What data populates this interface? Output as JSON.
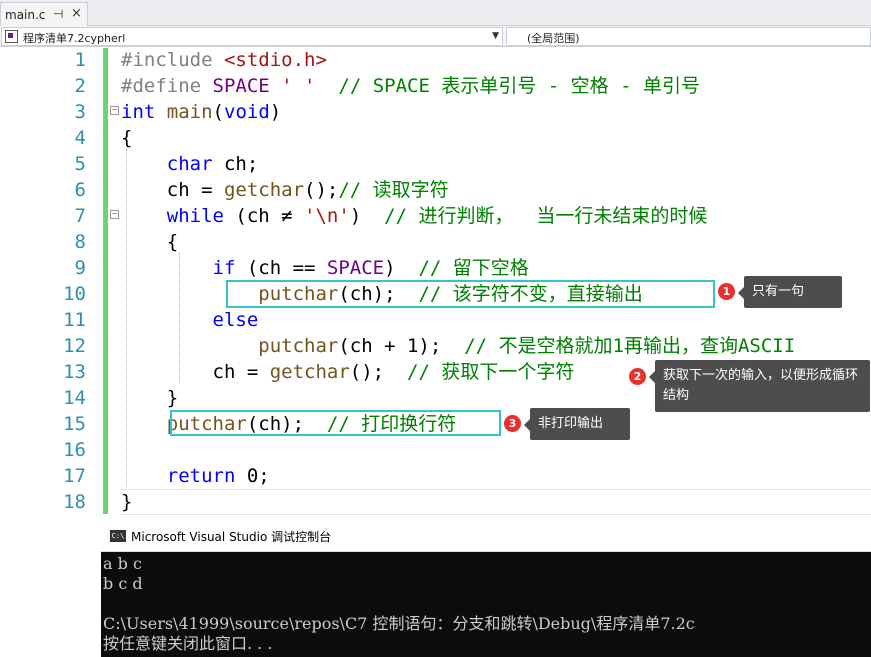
{
  "tab": {
    "label": "main.c",
    "pin_icon": "pin-icon",
    "close_icon": "close-icon"
  },
  "navbar": {
    "project": "程序清单7.2cypherl",
    "scope": "(全局范围)"
  },
  "editor": {
    "line_numbers": [
      "1",
      "2",
      "3",
      "4",
      "5",
      "6",
      "7",
      "8",
      "9",
      "10",
      "11",
      "12",
      "13",
      "14",
      "15",
      "16",
      "17",
      "18"
    ],
    "lines": [
      {
        "parts": [
          {
            "c": "pp",
            "t": "#include "
          },
          {
            "c": "inc",
            "t": "<stdio.h>"
          }
        ]
      },
      {
        "parts": [
          {
            "c": "pp",
            "t": "#define "
          },
          {
            "c": "mac",
            "t": "SPACE"
          },
          {
            "c": "op",
            "t": " "
          },
          {
            "c": "str",
            "t": "' '"
          },
          {
            "c": "op",
            "t": "  "
          },
          {
            "c": "cm",
            "t": "// SPACE 表示单引号 - 空格 - 单引号"
          }
        ]
      },
      {
        "parts": [
          {
            "c": "kw",
            "t": "int"
          },
          {
            "c": "op",
            "t": " "
          },
          {
            "c": "fn",
            "t": "main"
          },
          {
            "c": "op",
            "t": "("
          },
          {
            "c": "kw",
            "t": "void"
          },
          {
            "c": "op",
            "t": ")"
          }
        ]
      },
      {
        "parts": [
          {
            "c": "op",
            "t": "{"
          }
        ]
      },
      {
        "parts": [
          {
            "c": "op",
            "t": "    "
          },
          {
            "c": "kw",
            "t": "char"
          },
          {
            "c": "op",
            "t": " ch;"
          }
        ]
      },
      {
        "parts": [
          {
            "c": "op",
            "t": "    ch = "
          },
          {
            "c": "fn",
            "t": "getchar"
          },
          {
            "c": "op",
            "t": "();"
          },
          {
            "c": "cm",
            "t": "// 读取字符"
          }
        ]
      },
      {
        "parts": [
          {
            "c": "op",
            "t": "    "
          },
          {
            "c": "kw",
            "t": "while"
          },
          {
            "c": "op",
            "t": " (ch ≠ "
          },
          {
            "c": "str",
            "t": "'\\n'"
          },
          {
            "c": "op",
            "t": ")  "
          },
          {
            "c": "cm",
            "t": "// 进行判断，  当一行未结束的时候"
          }
        ]
      },
      {
        "parts": [
          {
            "c": "op",
            "t": "    {"
          }
        ]
      },
      {
        "parts": [
          {
            "c": "op",
            "t": "        "
          },
          {
            "c": "kw",
            "t": "if"
          },
          {
            "c": "op",
            "t": " (ch == "
          },
          {
            "c": "mac",
            "t": "SPACE"
          },
          {
            "c": "op",
            "t": ")  "
          },
          {
            "c": "cm",
            "t": "// 留下空格"
          }
        ]
      },
      {
        "parts": [
          {
            "c": "op",
            "t": "            "
          },
          {
            "c": "fn",
            "t": "putchar"
          },
          {
            "c": "op",
            "t": "(ch);  "
          },
          {
            "c": "cm",
            "t": "// 该字符不变，直接输出"
          }
        ]
      },
      {
        "parts": [
          {
            "c": "op",
            "t": "        "
          },
          {
            "c": "kw",
            "t": "else"
          }
        ]
      },
      {
        "parts": [
          {
            "c": "op",
            "t": "            "
          },
          {
            "c": "fn",
            "t": "putchar"
          },
          {
            "c": "op",
            "t": "(ch + 1);  "
          },
          {
            "c": "cm",
            "t": "// 不是空格就加1再输出，查询ASCII"
          }
        ]
      },
      {
        "parts": [
          {
            "c": "op",
            "t": "        ch = "
          },
          {
            "c": "fn",
            "t": "getchar"
          },
          {
            "c": "op",
            "t": "();  "
          },
          {
            "c": "cm",
            "t": "// 获取下一个字符"
          }
        ]
      },
      {
        "parts": [
          {
            "c": "op",
            "t": "    }"
          }
        ]
      },
      {
        "parts": [
          {
            "c": "op",
            "t": "    "
          },
          {
            "c": "fn",
            "t": "putchar"
          },
          {
            "c": "op",
            "t": "(ch);  "
          },
          {
            "c": "cm",
            "t": "// 打印换行符"
          }
        ]
      },
      {
        "parts": []
      },
      {
        "parts": [
          {
            "c": "op",
            "t": "    "
          },
          {
            "c": "kw",
            "t": "return"
          },
          {
            "c": "op",
            "t": " 0;"
          }
        ]
      },
      {
        "parts": [
          {
            "c": "op",
            "t": "}"
          }
        ]
      }
    ]
  },
  "annotations": [
    {
      "num": "1",
      "text": "只有一句"
    },
    {
      "num": "2",
      "text": "获取下一次的输入，以便形成循环结构"
    },
    {
      "num": "3",
      "text": "非打印输出"
    }
  ],
  "console": {
    "icon": "console-icon",
    "title": "Microsoft Visual Studio 调试控制台",
    "lines": [
      "a b c",
      "b c d",
      "",
      "C:\\Users\\41999\\source\\repos\\C7 控制语句：分支和跳转\\Debug\\程序清单7.2c",
      "按任意键关闭此窗口. . ."
    ]
  }
}
